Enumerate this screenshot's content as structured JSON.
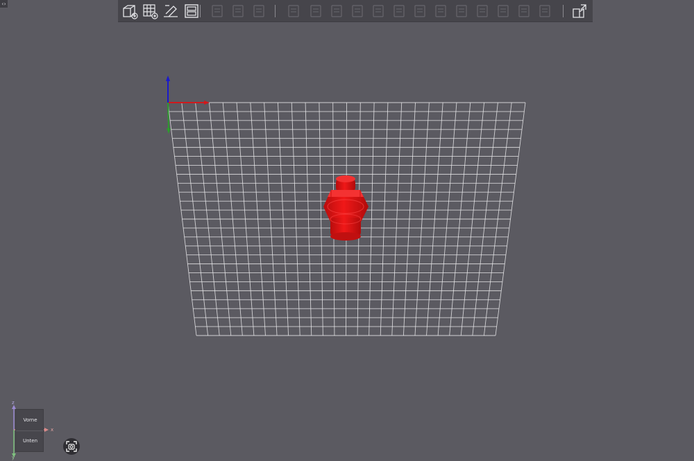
{
  "toolbar": {
    "buttons": [
      {
        "name": "add-box-icon",
        "state": "enabled"
      },
      {
        "name": "add-grid-icon",
        "state": "enabled"
      },
      {
        "name": "print-bed-icon",
        "state": "enabled"
      },
      {
        "name": "layout-panel-icon",
        "state": "enabled"
      },
      {
        "name": "copy-icon",
        "state": "disabled"
      },
      {
        "name": "paste-icon",
        "state": "disabled"
      },
      {
        "name": "layers-icon",
        "state": "disabled"
      },
      {
        "name": "move-icon",
        "state": "disabled"
      },
      {
        "name": "rotate-icon",
        "state": "disabled"
      },
      {
        "name": "scale-icon",
        "state": "disabled"
      },
      {
        "name": "place-on-face-icon",
        "state": "disabled"
      },
      {
        "name": "cut-icon",
        "state": "disabled"
      },
      {
        "name": "split-icon",
        "state": "disabled"
      },
      {
        "name": "support-icon",
        "state": "disabled"
      },
      {
        "name": "hollow-icon",
        "state": "disabled"
      },
      {
        "name": "text-emboss-icon",
        "state": "disabled"
      },
      {
        "name": "measure-icon",
        "state": "disabled"
      },
      {
        "name": "brim-icon",
        "state": "disabled"
      },
      {
        "name": "arrange-icon",
        "state": "disabled"
      },
      {
        "name": "frame-icon",
        "state": "disabled"
      },
      {
        "name": "export-icon",
        "state": "enabled"
      }
    ]
  },
  "corner_toggle": "‹›",
  "navcube": {
    "top_face": "Vorne",
    "bottom_face": "Unten",
    "axis_z": "z",
    "axis_x": "x",
    "axis_y": "y"
  },
  "colors": {
    "background": "#5b5a61",
    "toolbar": "#46454b",
    "grid_line": "#e8e8ea",
    "model": "#e01010",
    "axis_x": "#d0191c",
    "axis_y": "#2e9a2e",
    "axis_z": "#1a1acb"
  }
}
